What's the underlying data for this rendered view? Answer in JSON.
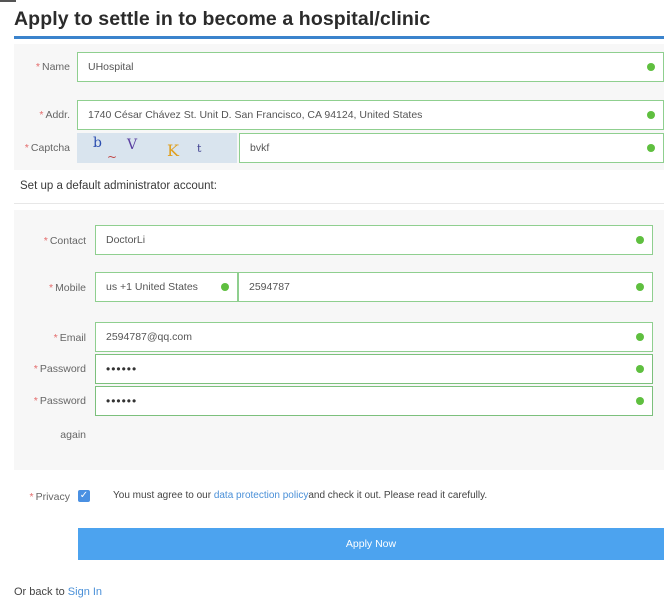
{
  "page": {
    "title": "Apply to settle in to become a hospital/clinic"
  },
  "form": {
    "name": {
      "label": "Name",
      "value": "UHospital"
    },
    "addr": {
      "label": "Addr.",
      "value": "1740 César Chávez St. Unit D. San Francisco, CA 94124, United States"
    },
    "captcha": {
      "label": "Captcha",
      "image_text": "b V K t",
      "value": "bvkf"
    }
  },
  "admin": {
    "section_title": "Set up a default administrator account:",
    "contact": {
      "label": "Contact",
      "value": "DoctorLi"
    },
    "mobile": {
      "label": "Mobile",
      "country": "us +1 United States",
      "value": "2594787"
    },
    "email": {
      "label": "Email",
      "value": "2594787@qq.com"
    },
    "password": {
      "label": "Password",
      "value": "••••••"
    },
    "password_again": {
      "label": "Password",
      "label_line2": "again",
      "value": "••••••"
    }
  },
  "privacy": {
    "label": "Privacy",
    "text_before": "You must agree to our ",
    "link": "data protection policy",
    "text_after": "and check it out. Please read it carefully."
  },
  "actions": {
    "apply_label": "Apply Now"
  },
  "footer": {
    "text": "Or back to ",
    "link": "Sign In"
  },
  "colors": {
    "accent": "#4ca3ef",
    "valid": "#5fbf3f",
    "required": "#e46b6b"
  }
}
